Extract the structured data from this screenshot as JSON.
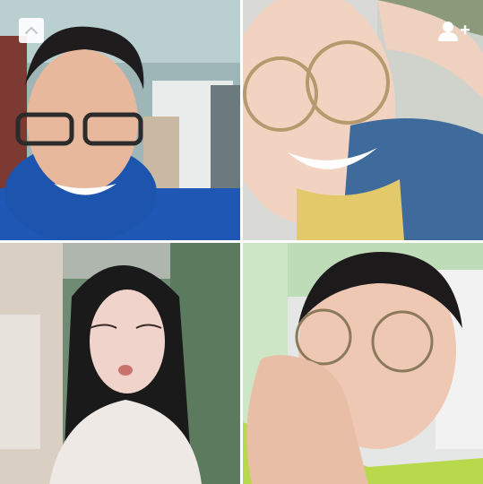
{
  "call": {
    "participants": [
      {
        "id": "p1",
        "label": "participant-video-1"
      },
      {
        "id": "p2",
        "label": "participant-video-2"
      },
      {
        "id": "p3",
        "label": "participant-video-3"
      },
      {
        "id": "p4",
        "label": "participant-video-4"
      }
    ]
  },
  "controls": {
    "collapse_icon": "chevron-up-icon",
    "add_user_icon": "add-user-icon"
  },
  "colors": {
    "divider": "#ffffff",
    "control_bg": "#ffffff",
    "control_fg": "#c8c8c8"
  }
}
